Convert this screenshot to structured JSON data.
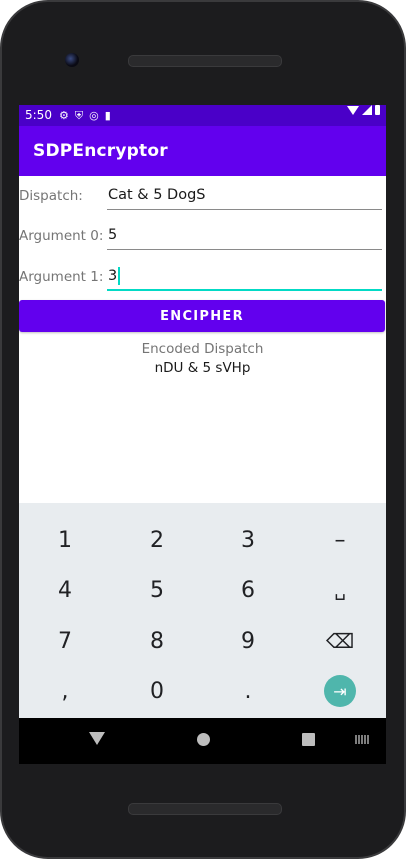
{
  "status_bar": {
    "time": "5:50",
    "left_icons": [
      "gear-icon",
      "shield-icon",
      "target-icon",
      "sd-card-icon"
    ],
    "right_icons": [
      "wifi-icon",
      "signal-icon",
      "battery-icon"
    ]
  },
  "app_bar": {
    "title": "SDPEncryptor",
    "color": "#6200ee"
  },
  "form": {
    "dispatch": {
      "label": "Dispatch:",
      "value": "Cat & 5 DogS"
    },
    "argument0": {
      "label": "Argument 0:",
      "value": "5"
    },
    "argument1": {
      "label": "Argument 1:",
      "value": "3"
    }
  },
  "encipher_button": {
    "label": "ENCIPHER",
    "color": "#6200ee"
  },
  "result": {
    "label": "Encoded Dispatch",
    "value": "nDU & 5 sVHp"
  },
  "keyboard": {
    "rows": [
      [
        "1",
        "2",
        "3",
        "–"
      ],
      [
        "4",
        "5",
        "6",
        "␣"
      ],
      [
        "7",
        "8",
        "9",
        "⌫"
      ],
      [
        ",",
        "0",
        ".",
        "⇥"
      ]
    ],
    "accent": "#4fb6ac"
  },
  "nav_bar": {
    "icons": [
      "back-icon",
      "home-icon",
      "recents-icon",
      "keyboard-switch-icon"
    ]
  }
}
